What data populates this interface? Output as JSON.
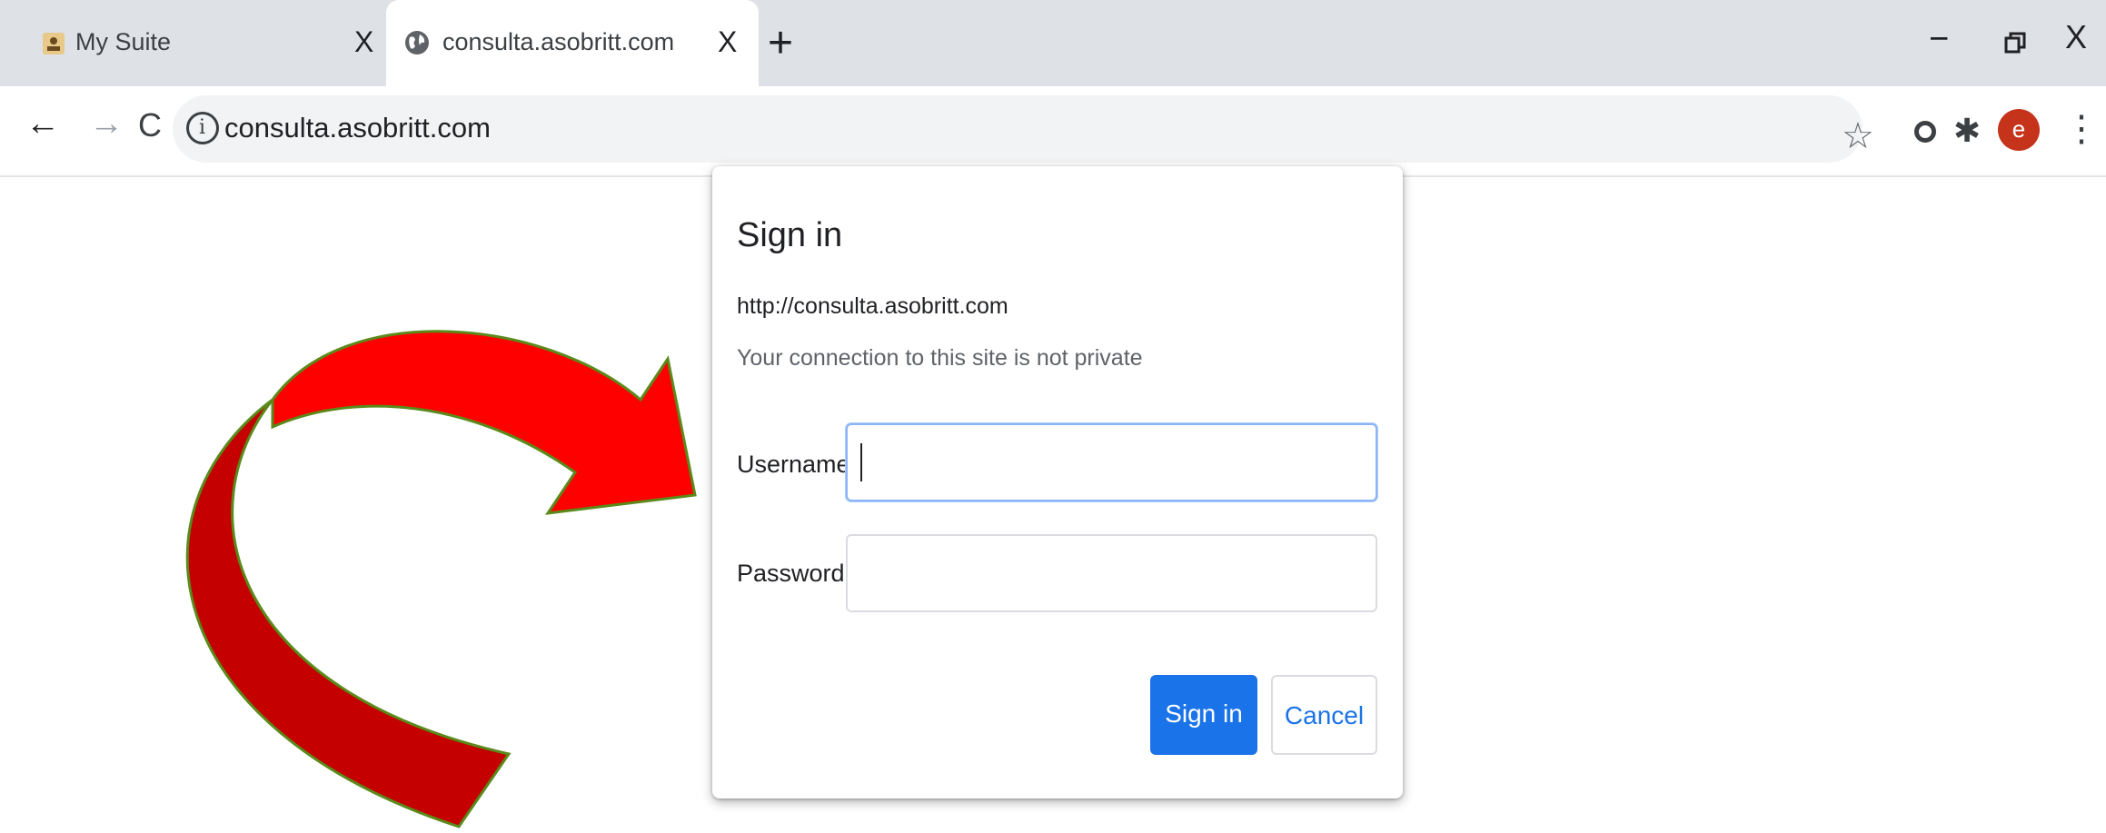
{
  "tabs": [
    {
      "title": "My Suite",
      "close": "X",
      "favicon": "suite-icon",
      "active": false
    },
    {
      "title": "consulta.asobritt.com",
      "close": "X",
      "favicon": "globe-icon",
      "active": true
    }
  ],
  "new_tab": "+",
  "window_controls": {
    "minimize": "−",
    "maximize": "⧉",
    "close": "X"
  },
  "toolbar": {
    "back": "←",
    "forward": "→",
    "reload": "C",
    "url": "consulta.asobritt.com",
    "star": "☆",
    "extensions": "✱",
    "avatar_letter": "e",
    "menu": "⋮"
  },
  "dialog": {
    "title": "Sign in",
    "origin": "http://consulta.asobritt.com",
    "warning": "Your connection to this site is not private",
    "username_label": "Username",
    "username_value": "",
    "password_label": "Password",
    "password_value": "",
    "signin_button": "Sign in",
    "cancel_button": "Cancel"
  },
  "colors": {
    "tabstrip_bg": "#dee1e6",
    "accent_blue": "#1a73e8",
    "avatar_bg": "#c5331b",
    "arrow_red": "#ff0000",
    "arrow_dark_red": "#c40000",
    "arrow_outline": "#5a8a1a"
  }
}
